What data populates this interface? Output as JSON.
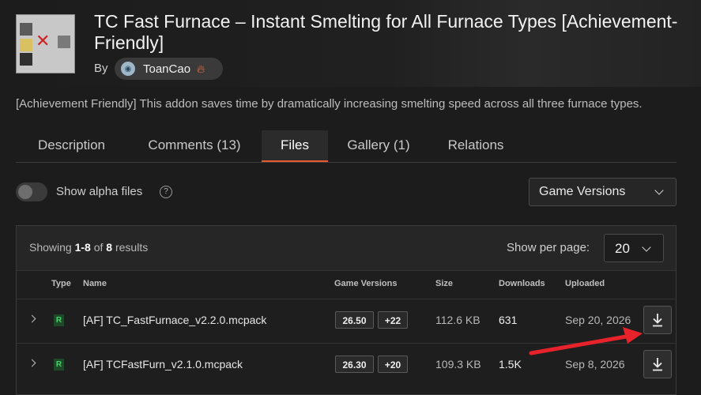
{
  "project": {
    "title": "TC Fast Furnace – Instant Smelting for All Furnace Types [Achievement-Friendly]",
    "by_label": "By",
    "author": "ToanCao",
    "summary": "[Achievement Friendly] This addon saves time by dramatically increasing smelting speed across all three furnace types."
  },
  "tabs": [
    {
      "label": "Description",
      "active": false
    },
    {
      "label": "Comments (13)",
      "active": false
    },
    {
      "label": "Files",
      "active": true
    },
    {
      "label": "Gallery (1)",
      "active": false
    },
    {
      "label": "Relations",
      "active": false
    }
  ],
  "filters": {
    "alpha_label": "Show alpha files",
    "alpha_enabled": false,
    "game_versions_label": "Game Versions"
  },
  "results": {
    "prefix": "Showing",
    "range": "1-8",
    "of": "of",
    "total": "8",
    "suffix": "results",
    "per_page_label": "Show per page:",
    "per_page_value": "20"
  },
  "table": {
    "headers": {
      "type": "Type",
      "name": "Name",
      "game_versions": "Game Versions",
      "size": "Size",
      "downloads": "Downloads",
      "uploaded": "Uploaded"
    },
    "rows": [
      {
        "type": "R",
        "name": "[AF] TC_FastFurnace_v2.2.0.mcpack",
        "version": "26.50",
        "extra_versions": "+22",
        "size": "112.6 KB",
        "downloads": "631",
        "uploaded": "Sep 20, 2026"
      },
      {
        "type": "R",
        "name": "[AF] TCFastFurn_v2.1.0.mcpack",
        "version": "26.30",
        "extra_versions": "+20",
        "size": "109.3 KB",
        "downloads": "1.5K",
        "uploaded": "Sep 8, 2026"
      }
    ]
  },
  "colors": {
    "accent": "#e35b2d",
    "release_badge": "#4cd06a",
    "annotation_arrow": "#e8222a"
  },
  "icons": {
    "help": "help-circle-icon",
    "dropdown": "chevron-down-icon",
    "download": "download-icon",
    "expand": "chevron-right-icon",
    "author_badge": "flame-icon"
  }
}
